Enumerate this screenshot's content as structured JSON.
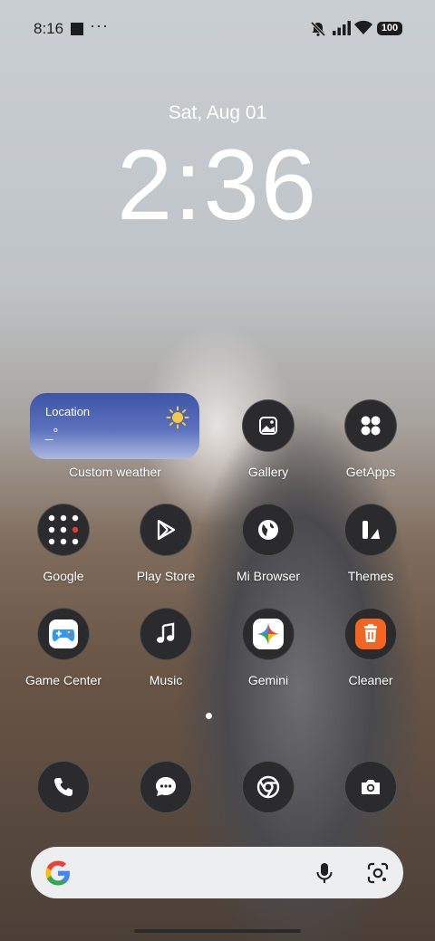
{
  "status_bar": {
    "time": "8:16",
    "more": "···",
    "battery": "100"
  },
  "lockscreen": {
    "date": "Sat, Aug 01",
    "clock": "2:36"
  },
  "weather_widget": {
    "location": "Location",
    "temperature": "_°",
    "label": "Custom weather"
  },
  "apps": {
    "gallery": "Gallery",
    "getapps": "GetApps",
    "google": "Google",
    "play_store": "Play Store",
    "mi_browser": "Mi Browser",
    "themes": "Themes",
    "game_center": "Game Center",
    "music": "Music",
    "gemini": "Gemini",
    "cleaner": "Cleaner"
  },
  "dock": [
    "phone-icon",
    "messages-icon",
    "chrome-icon",
    "camera-icon"
  ],
  "colors": {
    "icon_bg": "#2b2b2d",
    "weather_top": "#3e55a6",
    "cleaner_orange": "#f26522",
    "game_blue": "#2f9bf0"
  }
}
